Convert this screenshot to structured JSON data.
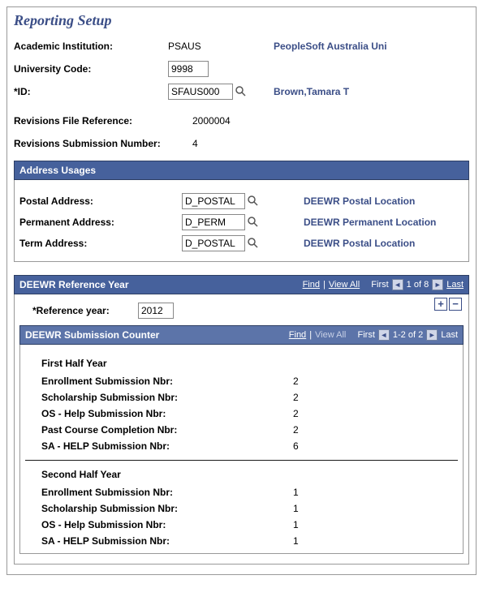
{
  "header": {
    "title": "Reporting Setup",
    "academic_institution_label": "Academic Institution:",
    "academic_institution_value": "PSAUS",
    "academic_institution_desc": "PeopleSoft Australia Uni",
    "university_code_label": "University Code:",
    "university_code_value": "9998",
    "id_label": "*ID:",
    "id_value": "SFAUS000",
    "id_desc": "Brown,Tamara T",
    "revisions_file_ref_label": "Revisions File Reference:",
    "revisions_file_ref_value": "2000004",
    "revisions_sub_num_label": "Revisions Submission Number:",
    "revisions_sub_num_value": "4"
  },
  "address_usages": {
    "title": "Address Usages",
    "postal_label": "Postal Address:",
    "postal_value": "D_POSTAL",
    "postal_desc": "DEEWR Postal Location",
    "permanent_label": "Permanent Address:",
    "permanent_value": "D_PERM",
    "permanent_desc": "DEEWR Permanent Location",
    "term_label": "Term Address:",
    "term_value": "D_POSTAL",
    "term_desc": "DEEWR Postal Location"
  },
  "deewr_ref_year": {
    "title": "DEEWR Reference Year",
    "find": "Find",
    "view_all": "View All",
    "first": "First",
    "last": "Last",
    "page_of": "1 of 8",
    "ref_year_label": "*Reference year:",
    "ref_year_value": "2012"
  },
  "deewr_sub_counter": {
    "title": "DEEWR Submission Counter",
    "find": "Find",
    "view_all": "View All",
    "first": "First",
    "last": "Last",
    "page_of": "1-2 of 2",
    "first_half_title": "First Half Year",
    "second_half_title": "Second Half Year",
    "rows": {
      "enroll_label": "Enrollment Submission Nbr:",
      "scholarship_label": "Scholarship Submission Nbr:",
      "oshelp_label": "OS - Help Submission Nbr:",
      "pastcourse_label": "Past Course Completion Nbr:",
      "sahelp_label": "SA - HELP Submission Nbr:"
    },
    "first_half": {
      "enroll": "2",
      "scholarship": "2",
      "oshelp": "2",
      "pastcourse": "2",
      "sahelp": "6"
    },
    "second_half": {
      "enroll": "1",
      "scholarship": "1",
      "oshelp": "1",
      "sahelp": "1"
    }
  }
}
